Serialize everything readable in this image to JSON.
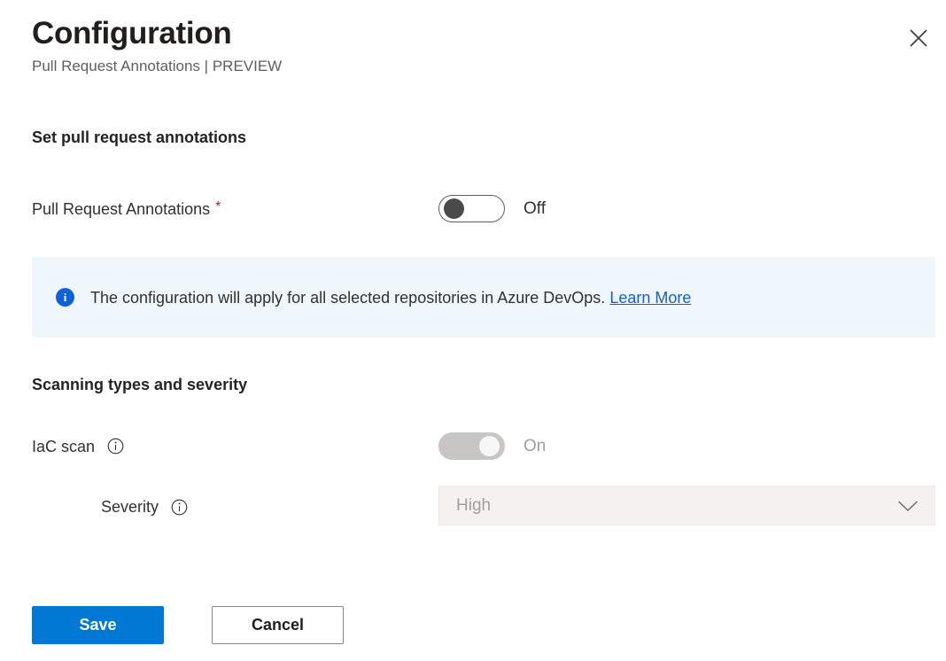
{
  "header": {
    "title": "Configuration",
    "subtitle": "Pull Request Annotations | PREVIEW",
    "close_icon": "close-icon"
  },
  "sections": [
    {
      "heading": "Set pull request annotations"
    },
    {
      "heading": "Scanning types and severity"
    }
  ],
  "pull_request_annotations": {
    "label": "Pull Request Annotations",
    "required_marker": "*",
    "toggle_state": "Off",
    "toggle_enabled": true
  },
  "banner": {
    "icon": "info-icon",
    "text": "The configuration will apply for all selected repositories in Azure DevOps.",
    "link_label": "Learn More",
    "background": "#eff6fc",
    "icon_color": "#0f62d4",
    "link_color": "#0f62d4"
  },
  "iac_scan": {
    "label": "IaC scan",
    "info_icon": "info-icon",
    "toggle_state": "On",
    "toggle_enabled": false
  },
  "severity": {
    "label": "Severity",
    "info_icon": "info-icon",
    "value": "High",
    "chevron_icon": "chevron-down-icon",
    "enabled": false
  },
  "footer": {
    "save_label": "Save",
    "cancel_label": "Cancel",
    "primary_color": "#0078d4"
  }
}
